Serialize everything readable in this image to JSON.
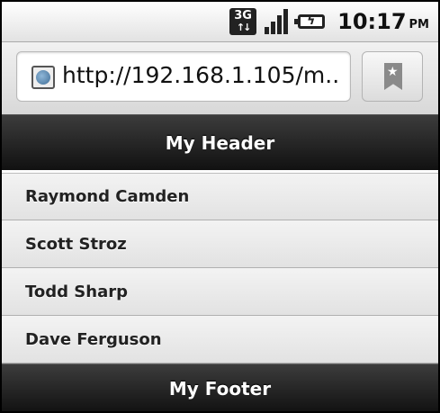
{
  "status_bar": {
    "network_label": "3G",
    "time": "10:17",
    "ampm": "PM",
    "icons": [
      "network-3g-icon",
      "signal-strength-icon",
      "battery-charging-icon"
    ]
  },
  "browser": {
    "url": "http://192.168.1.105/m...",
    "icons": [
      "globe-icon",
      "bookmark-icon"
    ]
  },
  "page": {
    "header_title": "My Header",
    "footer_title": "My Footer",
    "list_items": [
      {
        "label": "Raymond Camden"
      },
      {
        "label": "Scott Stroz"
      },
      {
        "label": "Todd Sharp"
      },
      {
        "label": "Dave Ferguson"
      }
    ]
  }
}
